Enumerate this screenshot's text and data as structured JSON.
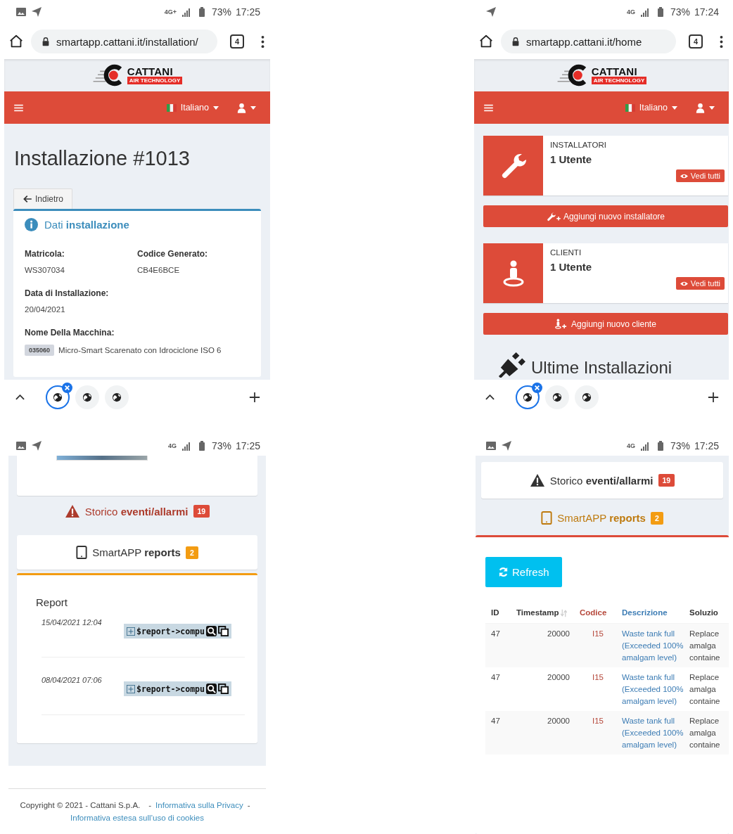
{
  "screens": [
    {
      "kind": "installation",
      "status_bar": {
        "notifications": [
          {
            "kind": "image"
          },
          {
            "kind": "send"
          }
        ],
        "network": "4G+",
        "battery": "73%",
        "time": "17:25"
      },
      "browser": {
        "url": "smartapp.cattani.it/installation/",
        "tab_count": "4"
      },
      "logo": {
        "name": "CATTANI",
        "tagline": "AIR TECHNOLOGY"
      },
      "navbar": {
        "language": "Italiano"
      },
      "title": "Installazione #1013",
      "back": "Indietro",
      "card": {
        "title": "Dati **installazione**",
        "rows": [
          [
            {
              "label": "Matricola:",
              "value": "WS307034"
            },
            {
              "label": "Codice Generato:",
              "value": "CB4E6BCE"
            }
          ],
          [
            {
              "label": "Data di Installazione:",
              "value": "20/04/2021"
            }
          ],
          [
            {
              "label": "Nome Della Macchina:",
              "code": "035060",
              "value": "Micro-Smart Scarenato con Idrociclone ISO 6"
            }
          ]
        ]
      },
      "tab_strip": {
        "tabs": [
          {
            "selected": true
          },
          {
            "selected": false
          },
          {
            "selected": false
          }
        ]
      }
    },
    {
      "kind": "home",
      "status_bar": {
        "notifications": [
          {
            "kind": "send"
          }
        ],
        "network": "4G",
        "battery": "73%",
        "time": "17:24"
      },
      "browser": {
        "url": "smartapp.cattani.it/home",
        "tab_count": "4"
      },
      "logo": {
        "name": "CATTANI",
        "tagline": "AIR TECHNOLOGY"
      },
      "navbar": {
        "language": "Italiano"
      },
      "stats": [
        {
          "kind": "installers",
          "label": "INSTALLATORI",
          "value": "1 Utente",
          "link": "Vedi tutti",
          "action": "Aggiungi nuovo installatore"
        },
        {
          "kind": "clients",
          "label": "CLIENTI",
          "value": "1 Utente",
          "link": "Vedi tutti",
          "action": "Aggiungi nuovo cliente"
        }
      ],
      "section_title": "Ultime Installazioni",
      "tab_strip": {
        "tabs": [
          {
            "selected": true
          },
          {
            "selected": false
          },
          {
            "selected": false
          }
        ]
      }
    },
    {
      "kind": "reports",
      "status_bar": {
        "notifications": [
          {
            "kind": "image"
          },
          {
            "kind": "send"
          }
        ],
        "network": "4G",
        "battery": "73%",
        "time": "17:25"
      },
      "tabs": [
        {
          "kind": "events",
          "label": "Storico **eventi/allarmi**",
          "count": "19",
          "color": "#dd4b39",
          "selected": false
        },
        {
          "kind": "reports",
          "label": "SmartAPP **reports**",
          "count": "2",
          "color": "#f39c12",
          "selected": true
        }
      ],
      "reports": {
        "title": "Report",
        "items": [
          {
            "time": "15/04/2021 12:04",
            "code": "$report->compu"
          },
          {
            "time": "08/04/2021 07:06",
            "code": "$report->compu"
          }
        ]
      },
      "footer": [
        {
          "kind": "text",
          "text": "Copyright © 2021 - Cattani S.p.A."
        },
        {
          "kind": "text",
          "text": "-"
        },
        {
          "kind": "link",
          "text": "Informativa sulla Privacy"
        },
        {
          "kind": "text",
          "text": "-"
        },
        {
          "kind": "link",
          "text": "Informativa estesa sull’uso di cookies"
        }
      ]
    },
    {
      "kind": "events",
      "status_bar": {
        "notifications": [
          {
            "kind": "image"
          },
          {
            "kind": "send"
          }
        ],
        "network": "4G",
        "battery": "73%",
        "time": "17:25"
      },
      "tabs": [
        {
          "kind": "events",
          "label": "Storico **eventi/allarmi**",
          "count": "19",
          "color": "#dd4b39",
          "selected": true
        },
        {
          "kind": "reports",
          "label": "SmartAPP **reports**",
          "count": "2",
          "color": "#f39c12",
          "selected": false
        }
      ],
      "refresh": "Refresh",
      "table": {
        "columns": [
          {
            "label": "ID",
            "sortable": false
          },
          {
            "label": "Timestamp",
            "sortable": true
          },
          {
            "label": "Codice",
            "sortable": false,
            "color": "#b5473a"
          },
          {
            "label": "Descrizione",
            "sortable": false,
            "color": "#3c7cb4"
          },
          {
            "label": "Soluzio",
            "sortable": false
          }
        ],
        "rows": [
          [
            "47",
            "20000",
            "I15",
            "Waste tank full (Exceeded 100% amalgam level)",
            "Replace amalga containe"
          ],
          [
            "47",
            "20000",
            "I15",
            "Waste tank full (Exceeded 100% amalgam level)",
            "Replace amalga containe"
          ],
          [
            "47",
            "20000",
            "I15",
            "Waste tank full (Exceeded 100% amalgam level)",
            "Replace amalga containe"
          ]
        ]
      }
    }
  ]
}
